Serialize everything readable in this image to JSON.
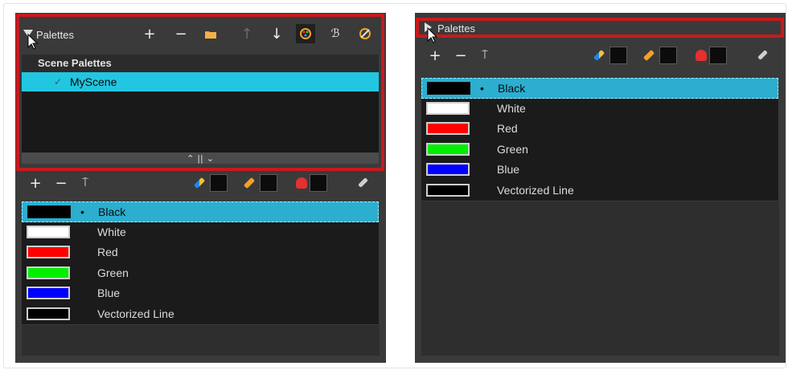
{
  "left_panel": {
    "title": "Palettes",
    "toolbar_icons": [
      "add-palette-icon",
      "remove-palette-icon",
      "folder-icon",
      "move-up-icon",
      "move-down-icon",
      "palette-edit-icon",
      "brush-icon",
      "palette-settings-icon"
    ],
    "scene_palettes_header": "Scene Palettes",
    "scene_palette_item": {
      "check": "✓",
      "name": "MyScene"
    },
    "divider": {
      "up": "⌃",
      "sep": "||",
      "down": "⌄"
    },
    "colors": [
      {
        "name": "Black",
        "hex": "#000000",
        "selected": true,
        "bullet": "•"
      },
      {
        "name": "White",
        "hex": "#ffffff"
      },
      {
        "name": "Red",
        "hex": "#ff0000"
      },
      {
        "name": "Green",
        "hex": "#00ee00"
      },
      {
        "name": "Blue",
        "hex": "#0000ff"
      },
      {
        "name": "Vectorized Line",
        "hex": "#000000"
      }
    ]
  },
  "right_panel": {
    "title": "Palettes",
    "colors": [
      {
        "name": "Black",
        "hex": "#000000",
        "selected": true,
        "bullet": "•"
      },
      {
        "name": "White",
        "hex": "#ffffff"
      },
      {
        "name": "Red",
        "hex": "#ff0000"
      },
      {
        "name": "Green",
        "hex": "#00ee00"
      },
      {
        "name": "Blue",
        "hex": "#0000ff"
      },
      {
        "name": "Vectorized Line",
        "hex": "#000000"
      }
    ]
  },
  "colors_toolbar": {
    "add": "+",
    "remove": "−",
    "clone": "⍑"
  },
  "accent": {
    "highlight": "#22c6e0",
    "selection": "#2caed0",
    "red_callout": "#c8191e"
  }
}
